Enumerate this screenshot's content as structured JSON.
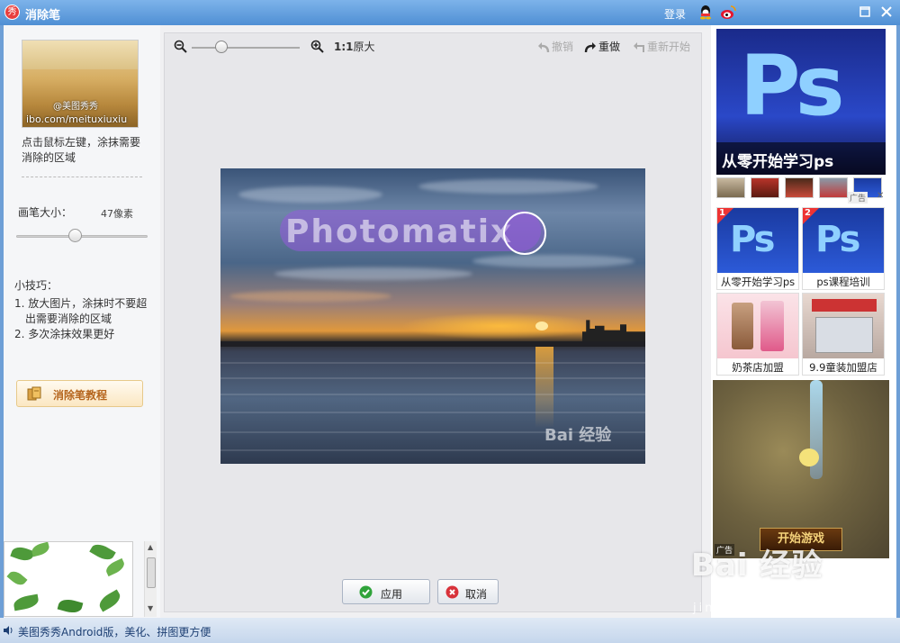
{
  "window": {
    "title": "消除笔",
    "logo_char": "秀",
    "login": "登录"
  },
  "left": {
    "thumb_watermark": "ibo.com/meituxiuxiu",
    "thumb_watermark2": "@美图秀秀",
    "instruction": "点击鼠标左键，涂抹需要消除的区域",
    "brush_label": "画笔大小：",
    "brush_value": "47像素",
    "tips_title": "小技巧：",
    "tips": [
      "1. 放大图片，涂抹时不要超出需要消除的区域",
      "2. 多次涂抹效果更好"
    ],
    "tutorial_button": "消除笔教程"
  },
  "toolbar": {
    "actual_size_ratio": "1:1",
    "actual_size_label": "原大",
    "undo": "撤销",
    "redo": "重做",
    "restart": "重新开始"
  },
  "canvas": {
    "overlay_text": "Photomatix",
    "photo_watermark": "Bai 经验"
  },
  "buttons": {
    "apply": "应用",
    "cancel": "取消"
  },
  "ads": {
    "ps_logo": "Ps",
    "ps_caption": "从零开始学习ps",
    "ad_tag": "广告",
    "tiles": [
      {
        "rank": "1",
        "label": "从零开始学习ps",
        "logo": "Ps"
      },
      {
        "rank": "2",
        "label": "ps课程培训",
        "logo": "Ps"
      },
      {
        "label": "奶茶店加盟"
      },
      {
        "label": "9.9童装加盟店"
      }
    ],
    "game_start": "开始游戏",
    "game_tag": "广告"
  },
  "status": {
    "text": "美图秀秀Android版，美化、拼图更方便"
  },
  "watermark": {
    "brand": "Bai 经验",
    "url": "jingyan.baidu.com"
  }
}
